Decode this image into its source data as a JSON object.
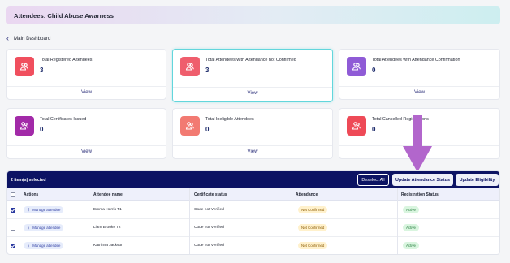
{
  "header": {
    "title": "Attendees: Child Abuse Awarness"
  },
  "nav": {
    "back_label": "Main Dashboard"
  },
  "colors": {
    "navy": "#0c1363",
    "accent_cyan": "#62d6dc",
    "arrow": "#b266cc"
  },
  "cards": [
    {
      "label": "Total Registered Attendees",
      "value": "3",
      "view": "View",
      "icon": "users-icon",
      "color": "#f04f5e"
    },
    {
      "label": "Total Attendees with Attendance not Confirmed",
      "value": "3",
      "view": "View",
      "icon": "users-icon",
      "color": "#ef5e6d"
    },
    {
      "label": "Total Attendees with Attendance Confirmation",
      "value": "0",
      "view": "View",
      "icon": "users-icon",
      "color": "#8f5bd6"
    },
    {
      "label": "Total Certificates Issued",
      "value": "0",
      "view": "View",
      "icon": "users-icon",
      "color": "#a22aa8"
    },
    {
      "label": "Total Ineligible Attendees",
      "value": "0",
      "view": "View",
      "icon": "users-icon",
      "color": "#f27a72"
    },
    {
      "label": "Total Cancelled Registrations",
      "value": "0",
      "view": "View",
      "icon": "users-icon",
      "color": "#ee4a57"
    }
  ],
  "table": {
    "selected_text": "2 item(s) selected",
    "buttons": {
      "deselect": "Deselect All",
      "update_attendance": "Update Attendance Status",
      "update_eligibility": "Update Eligibility"
    },
    "columns": [
      "Actions",
      "Attendee name",
      "Certificate status",
      "Attendance",
      "Registration Status"
    ],
    "rows": [
      {
        "checked": true,
        "action": "Manage attendee",
        "name": "Emma Harris T1",
        "certificate": "Code not Verified",
        "attendance": "Not Confirmed",
        "registration": "Active"
      },
      {
        "checked": false,
        "action": "Manage attendee",
        "name": "Liam Brooks T2",
        "certificate": "Code not Verified",
        "attendance": "Not Confirmed",
        "registration": "Active"
      },
      {
        "checked": true,
        "action": "Manage attendee",
        "name": "Katrinna Jackson",
        "certificate": "Code not Verified",
        "attendance": "Not Confirmed",
        "registration": "Active"
      }
    ]
  }
}
